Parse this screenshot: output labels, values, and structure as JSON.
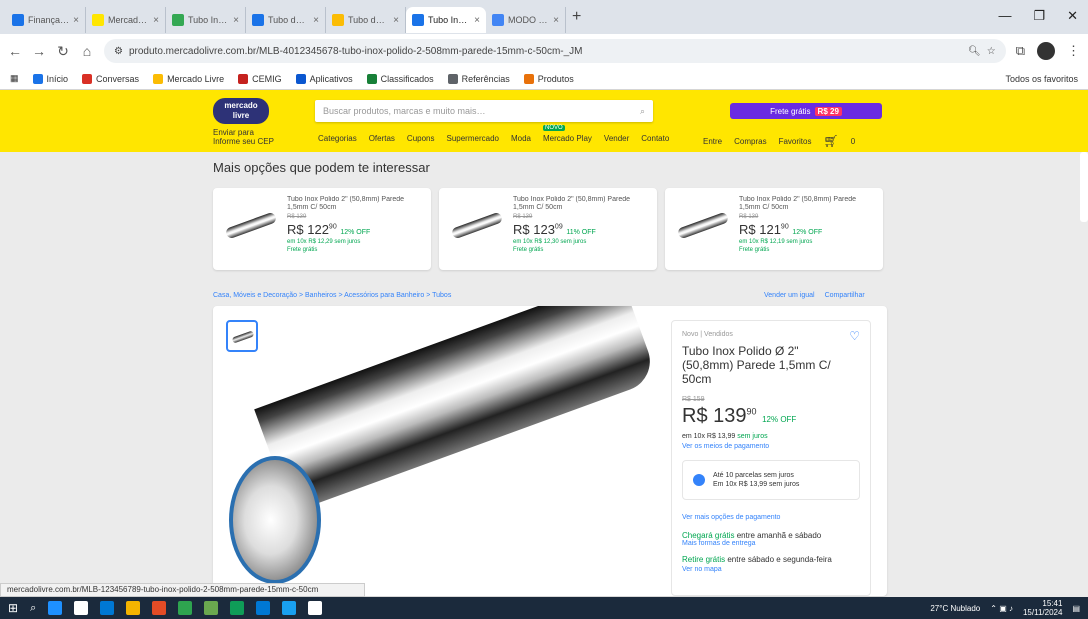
{
  "browser": {
    "tabs": [
      {
        "title": "Finanças | Gmail",
        "color": "#1a73e8"
      },
      {
        "title": "Mercado Livre",
        "color": "#ffe600"
      },
      {
        "title": "Tubo Inox Polido",
        "color": "#34a853"
      },
      {
        "title": "Tubo de aço inox",
        "color": "#1a73e8"
      },
      {
        "title": "Tubo de aço inox",
        "color": "#fbbc04"
      },
      {
        "title": "Tubo Inox Polido",
        "color": "#1a73e8",
        "active": true
      },
      {
        "title": "MODO DOMÉSTICO",
        "color": "#4285f4"
      }
    ],
    "new_tab": "+",
    "window_controls": {
      "minimize": "—",
      "maximize": "❐",
      "close": "✕"
    },
    "url": "produto.mercadolivre.com.br/MLB-4012345678-tubo-inox-polido-2-508mm-parede-15mm-c-50cm-_JM",
    "bookmarks": [
      {
        "label": "Início",
        "color": "#1a73e8"
      },
      {
        "label": "Conversas",
        "color": "#d93025"
      },
      {
        "label": "Mercado Livre",
        "color": "#fbbc04"
      },
      {
        "label": "CEMIG",
        "color": "#c5221f"
      },
      {
        "label": "Aplicativos",
        "color": "#0b57d0"
      },
      {
        "label": "Classificados",
        "color": "#188038"
      },
      {
        "label": "Referências",
        "color": "#5f6368"
      },
      {
        "label": "Produtos",
        "color": "#e8710a"
      }
    ],
    "bookmarks_more": "Todos os favoritos"
  },
  "ml_header": {
    "logo": "mercado livre",
    "search_placeholder": "Buscar produtos, marcas e muito mais…",
    "promo_text": "Frete grátis",
    "promo_badge": "R$ 29",
    "cep_line1": "Enviar para",
    "cep_line2": "Informe seu CEP",
    "nav": [
      "Categorias",
      "Ofertas",
      "Cupons",
      "Supermercado",
      "Moda",
      "Mercado Play",
      "Vender",
      "Contato"
    ],
    "user_nav": [
      "Entre",
      "Compras",
      "Favoritos"
    ],
    "cart_count": "0"
  },
  "suggestions": {
    "title": "Mais opções que podem te interessar",
    "items": [
      {
        "name": "Tubo Inox Polido 2\" (50,8mm) Parede 1,5mm C/ 50cm",
        "old": "R$ 139",
        "price": "R$ 122",
        "cents": "90",
        "off": "12% OFF",
        "inst": "em 10x R$ 12,29 sem juros",
        "ship": "Frete grátis"
      },
      {
        "name": "Tubo Inox Polido 2\" (50,8mm) Parede 1,5mm C/ 50cm",
        "old": "R$ 139",
        "price": "R$ 123",
        "cents": "09",
        "off": "11% OFF",
        "inst": "em 10x R$ 12,30 sem juros",
        "ship": "Frete grátis"
      },
      {
        "name": "Tubo Inox Polido 2\" (50,8mm) Parede 1,5mm C/ 50cm",
        "old": "R$ 139",
        "price": "R$ 121",
        "cents": "90",
        "off": "12% OFF",
        "inst": "em 10x R$ 12,19 sem juros",
        "ship": "Frete grátis"
      }
    ]
  },
  "breadcrumb": "Casa, Móveis e Decoração > Banheiros > Acessórios para Banheiro > Tubos",
  "top_links": [
    "Vender um igual",
    "Compartilhar"
  ],
  "product": {
    "condition": "Novo | Vendidos",
    "title": "Tubo Inox Polido Ø 2\" (50,8mm) Parede 1,5mm C/ 50cm",
    "old_price": "R$ 159",
    "price": "R$ 139",
    "cents": "90",
    "off": "12% OFF",
    "installment_prefix": "em 10x R$ 13,99",
    "installment_green": "sem juros",
    "payment_link": "Ver os meios de pagamento",
    "meli_line1": "Até 10 parcelas sem juros",
    "meli_line2": "Em 10x R$ 13,99 sem juros",
    "more_options": "Ver mais opções de pagamento",
    "shipping_green": "Chegará grátis",
    "shipping_text": "entre amanhã e sábado",
    "shipping_link": "Mais formas de entrega",
    "ship2_green": "Retire grátis",
    "ship2_text": "entre sábado e segunda-feira",
    "ship2_tail": "Ver no mapa"
  },
  "status_url": "mercadolivre.com.br/MLB-123456789-tubo-inox-polido-2-508mm-parede-15mm-c-50cm",
  "taskbar": {
    "apps": [
      "#1e90ff",
      "#ffffff",
      "#0078d4",
      "#f4b400",
      "#e34c26",
      "#2ea44f",
      "#6aa84f",
      "#0f9d58",
      "#0078d4",
      "#19a0f0",
      "#ffffff"
    ],
    "weather": "27°C Nublado",
    "time": "15:41",
    "date": "15/11/2024"
  }
}
